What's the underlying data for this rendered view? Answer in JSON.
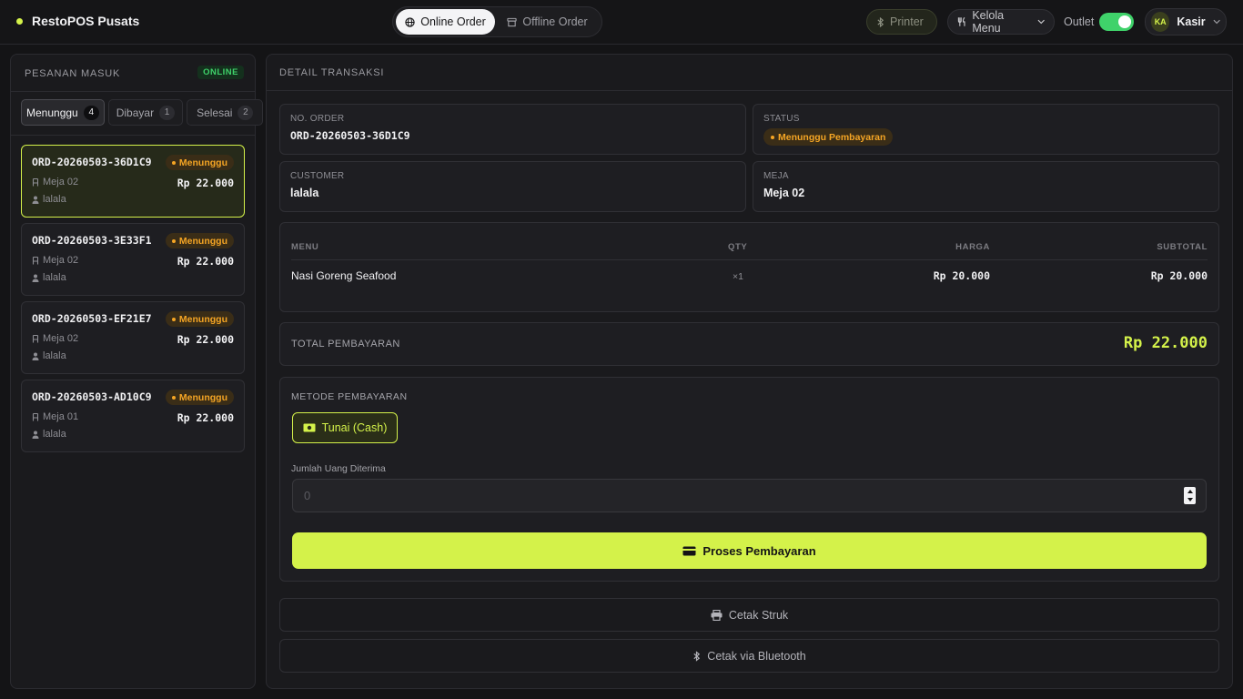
{
  "app": {
    "title": "RestoPOS Pusats"
  },
  "modes": [
    {
      "label": "Online Order",
      "icon": "globe-icon",
      "active": true
    },
    {
      "label": "Offline Order",
      "icon": "store-icon",
      "active": false
    }
  ],
  "header": {
    "printer_label": "Printer",
    "menu_label": "Kelola Menu",
    "outlet_label": "Outlet",
    "outlet_on": true,
    "user_initials": "KA",
    "user_name": "Kasir"
  },
  "orders_panel": {
    "title": "PESANAN MASUK",
    "status_badge": "ONLINE",
    "tabs": [
      {
        "label": "Menunggu",
        "count": "4",
        "active": true
      },
      {
        "label": "Dibayar",
        "count": "1",
        "active": false
      },
      {
        "label": "Selesai",
        "count": "2",
        "active": false
      }
    ],
    "orders": [
      {
        "id": "ORD-20260503-36D1C9",
        "status": "Menunggu",
        "table": "Meja 02",
        "price": "Rp 22.000",
        "customer": "lalala",
        "selected": true
      },
      {
        "id": "ORD-20260503-3E33F1",
        "status": "Menunggu",
        "table": "Meja 02",
        "price": "Rp 22.000",
        "customer": "lalala",
        "selected": false
      },
      {
        "id": "ORD-20260503-EF21E7",
        "status": "Menunggu",
        "table": "Meja 02",
        "price": "Rp 22.000",
        "customer": "lalala",
        "selected": false
      },
      {
        "id": "ORD-20260503-AD10C9",
        "status": "Menunggu",
        "table": "Meja 01",
        "price": "Rp 22.000",
        "customer": "lalala",
        "selected": false
      }
    ]
  },
  "detail": {
    "title": "DETAIL TRANSAKSI",
    "order_no_label": "NO. ORDER",
    "order_no": "ORD-20260503-36D1C9",
    "status_label": "STATUS",
    "status": "Menunggu Pembayaran",
    "customer_label": "CUSTOMER",
    "customer": "lalala",
    "table_label": "MEJA",
    "table": "Meja 02",
    "columns": {
      "menu": "MENU",
      "qty": "QTY",
      "price": "HARGA",
      "subtotal": "SUBTOTAL"
    },
    "items": [
      {
        "menu": "Nasi Goreng Seafood",
        "qty": "×1",
        "price": "Rp 20.000",
        "subtotal": "Rp 20.000"
      }
    ],
    "total_label": "TOTAL PEMBAYARAN",
    "total": "Rp 22.000",
    "payment_method_label": "METODE PEMBAYARAN",
    "payment_method": "Tunai (Cash)",
    "amount_label": "Jumlah Uang Diterima",
    "amount_placeholder": "0",
    "process_label": "Proses Pembayaran",
    "print_label": "Cetak Struk",
    "bluetooth_label": "Cetak via Bluetooth"
  },
  "colors": {
    "accent": "#d4f24a",
    "pending": "#f5a524",
    "online": "#3fd26a",
    "background": "#141416",
    "panel": "#1a1a1d"
  }
}
